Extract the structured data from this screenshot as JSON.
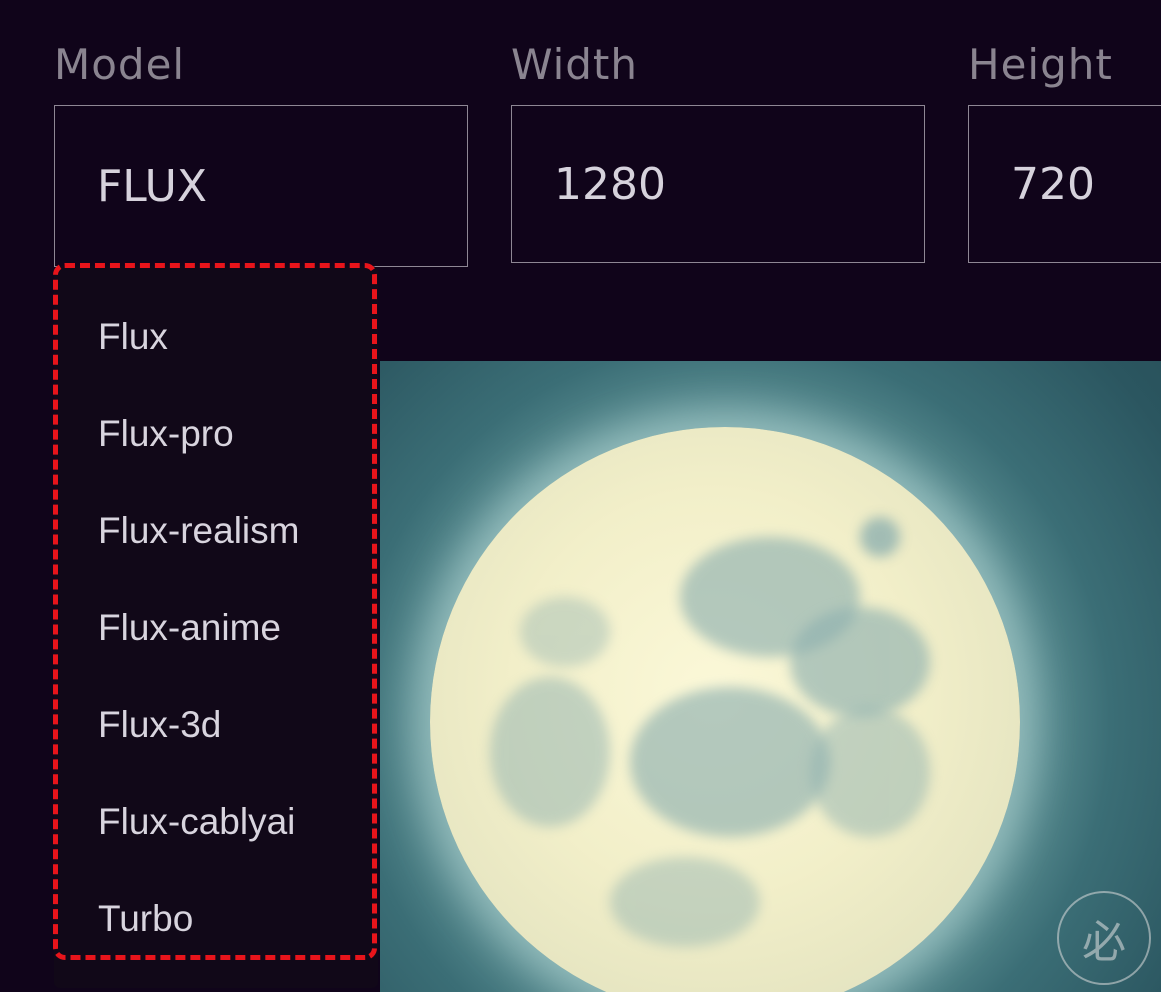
{
  "fields": {
    "model": {
      "label": "Model",
      "value": "FLUX"
    },
    "width": {
      "label": "Width",
      "value": "1280"
    },
    "height": {
      "label": "Height",
      "value": "720"
    }
  },
  "dropdown": {
    "options": [
      "Flux",
      "Flux-pro",
      "Flux-realism",
      "Flux-anime",
      "Flux-3d",
      "Flux-cablyai",
      "Turbo"
    ]
  },
  "colors": {
    "background": "#10041a",
    "highlight": "#e8141b",
    "field_border": "#8e8794",
    "text": "#d6d2dc"
  }
}
